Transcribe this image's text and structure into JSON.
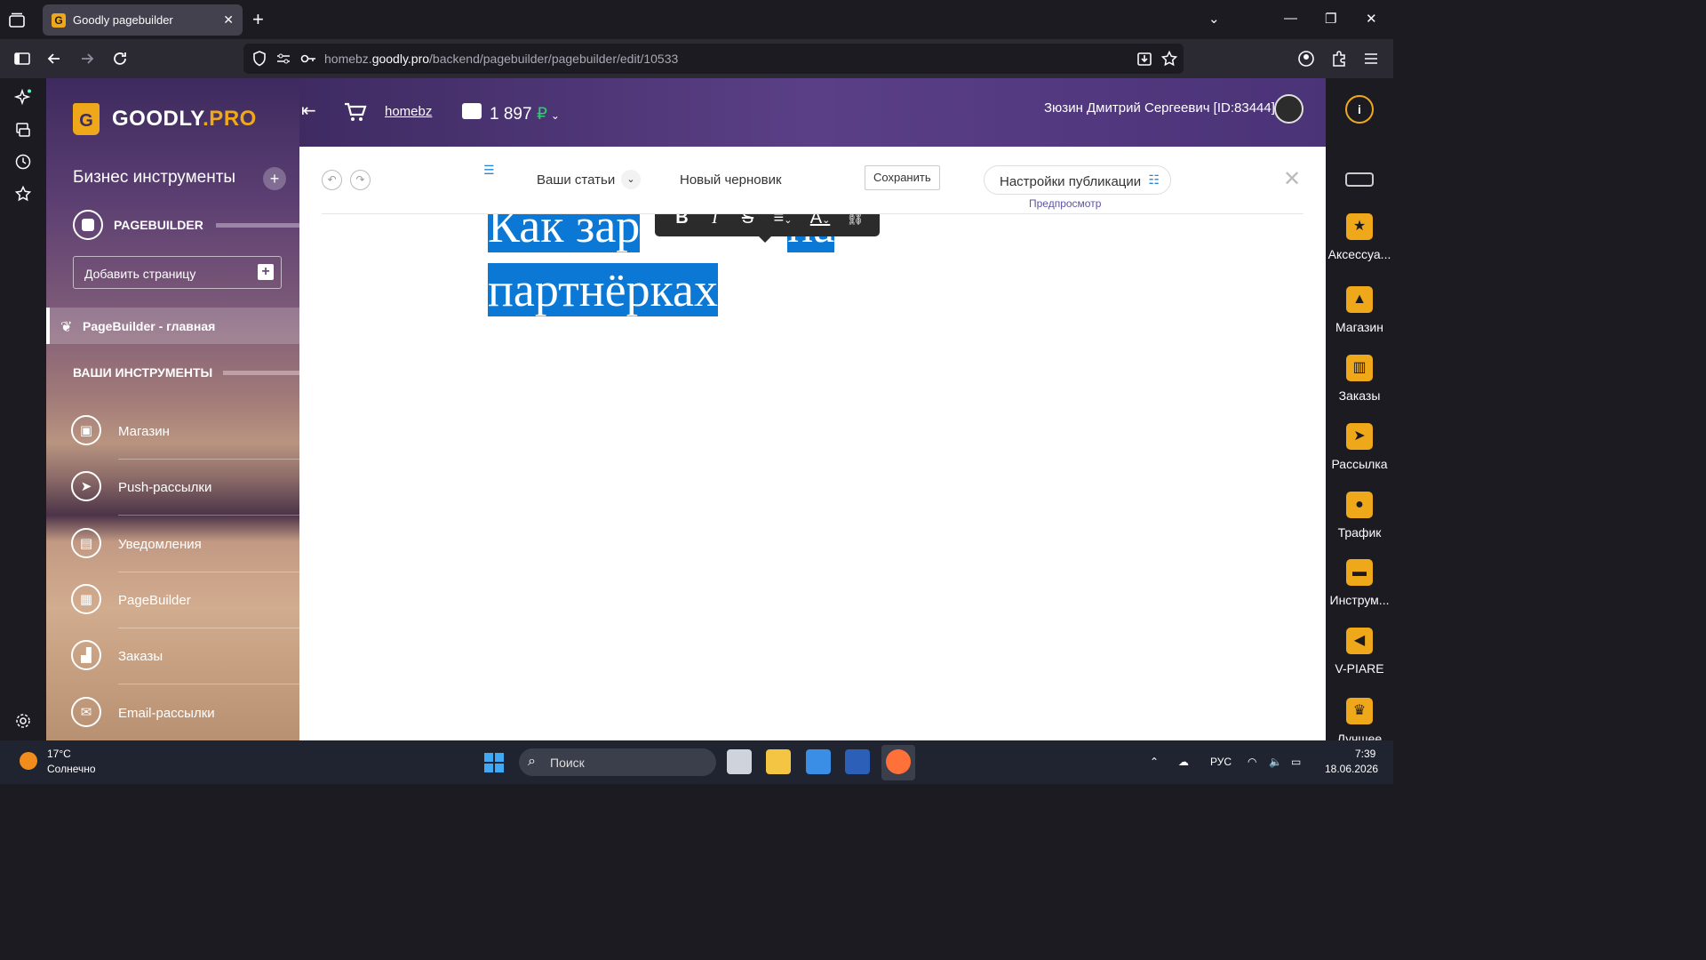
{
  "browser": {
    "tab_title": "Goodly pagebuilder",
    "tab_favicon": "G",
    "url_prefix": "homebz.",
    "url_domain": "goodly.pro",
    "url_path": "/backend/pagebuilder/pagebuilder/edit/10533"
  },
  "app": {
    "logo_main": "GOODLY",
    "logo_accent": ".PRO",
    "logo_icon": "G",
    "section_title": "Бизнес инструменты",
    "pagebuilder_label": "PAGEBUILDER",
    "add_page_label": "Добавить страницу",
    "pagebuilder_main_label": "PageBuilder - главная",
    "tools_title": "ВАШИ ИНСТРУМЕНТЫ",
    "tools": [
      {
        "label": "Магазин",
        "icon": "shopping-bag-icon"
      },
      {
        "label": "Push-рассылки",
        "icon": "paper-plane-icon"
      },
      {
        "label": "Уведомления",
        "icon": "notification-icon"
      },
      {
        "label": "PageBuilder",
        "icon": "layout-icon"
      },
      {
        "label": "Заказы",
        "icon": "chart-icon"
      },
      {
        "label": "Email-рассылки",
        "icon": "envelope-icon"
      }
    ]
  },
  "header": {
    "site_link": "homebz",
    "balance": "1 897",
    "currency": "₽",
    "user_name": "Зюзин Дмитрий Сергеевич [ID:83444]"
  },
  "editor": {
    "articles_label": "Ваши статьи",
    "draft_label": "Новый черновик",
    "save_label": "Сохранить",
    "publish_settings_label": "Настройки публикации",
    "preview_label": "Предпросмотр",
    "heading_line1": "Как зар",
    "heading_line1_end": "на",
    "heading_line2": "партнёрках",
    "format_buttons": [
      "B",
      "I",
      "S",
      "≡",
      "A",
      "🔗"
    ]
  },
  "widgets": [
    {
      "label": "Аксессуа...",
      "icon": "accessories-icon"
    },
    {
      "label": "Магазин",
      "icon": "shop-icon"
    },
    {
      "label": "Заказы",
      "icon": "orders-icon"
    },
    {
      "label": "Рассылка",
      "icon": "mailing-icon"
    },
    {
      "label": "Трафик",
      "icon": "traffic-icon"
    },
    {
      "label": "Инструм...",
      "icon": "tools-icon"
    },
    {
      "label": "V-PIARE",
      "icon": "megaphone-icon"
    },
    {
      "label": "Лучшее",
      "icon": "best-icon"
    }
  ],
  "taskbar": {
    "temperature": "17°C",
    "weather": "Солнечно",
    "search_placeholder": "Поиск",
    "language": "РУС",
    "time": "7:39",
    "date": "18.06.2026"
  }
}
